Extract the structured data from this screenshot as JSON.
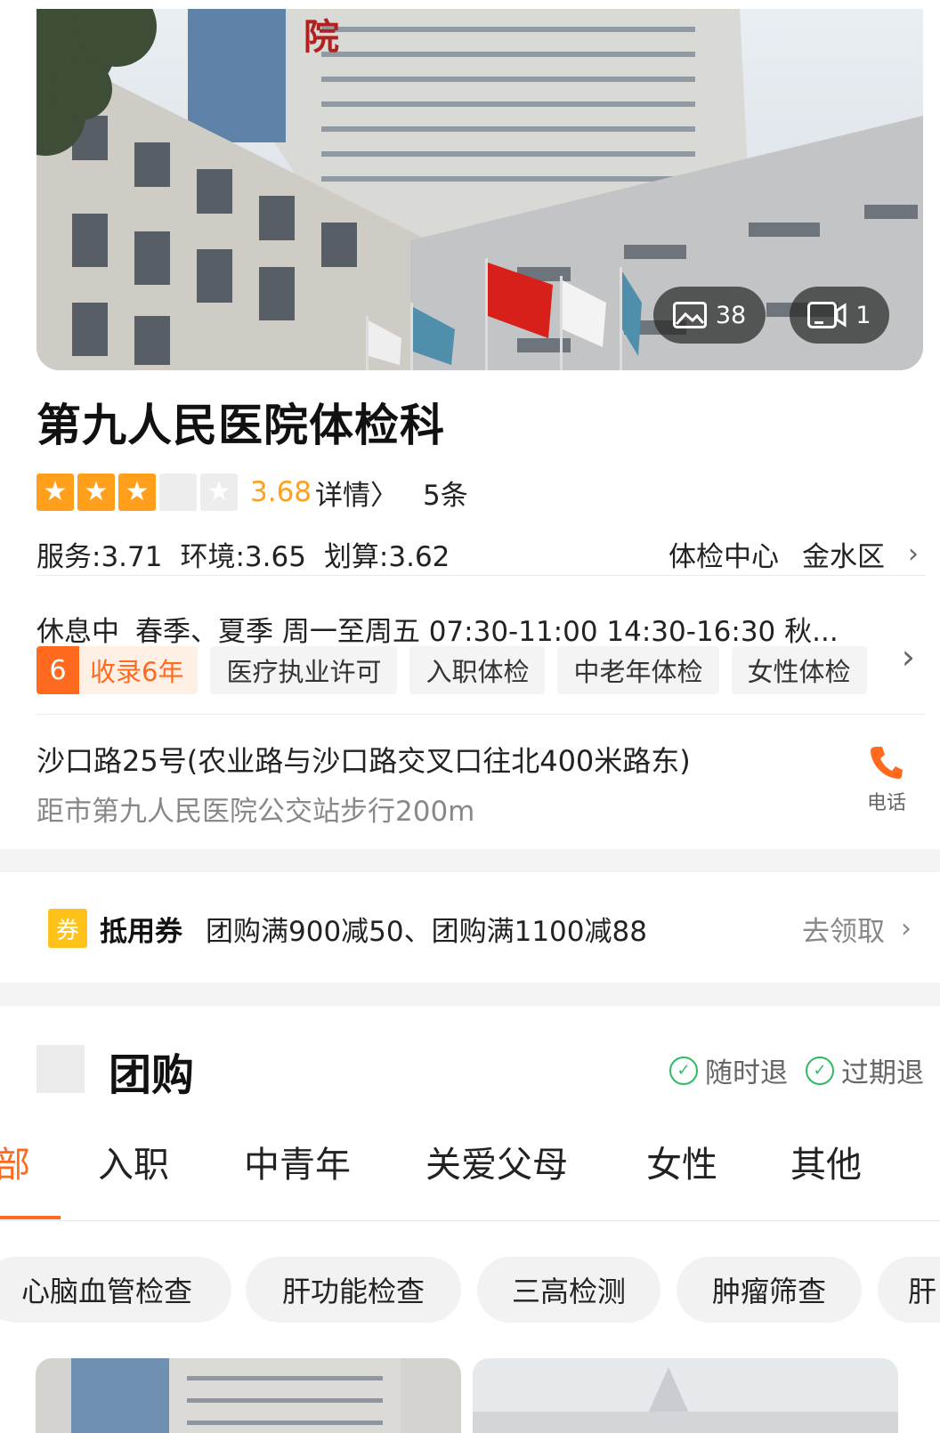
{
  "hero": {
    "photo_count": "38",
    "video_count": "1",
    "photo_icon": "image-icon",
    "video_icon": "video-camera-icon"
  },
  "shop": {
    "name": "第九人民医院体检科",
    "rating": 3.68,
    "rating_text": "3.68",
    "detail_link": "详情〉",
    "review_count": "5条",
    "sub_scores": [
      "服务:3.71",
      "环境:3.65",
      "划算:3.62"
    ],
    "category": "体检中心",
    "district": "金水区",
    "status": "休息中",
    "hours": "春季、夏季 周一至周五 07:30-11:00 14:30-16:30  秋...",
    "badge_num": "6",
    "badge_text": "收录6年",
    "tags": [
      "医疗执业许可",
      "入职体检",
      "中老年体检",
      "女性体检"
    ],
    "address": "沙口路25号(农业路与沙口路交叉口往北400米路东)",
    "address_hint": "距市第九人民医院公交站步行200m",
    "phone_label": "电话"
  },
  "coupon": {
    "icon_text": "券",
    "title": "抵用券",
    "text": "团购满900减50、团购满1100减88",
    "action": "去领取"
  },
  "groupbuy": {
    "title": "团购",
    "guarantees": [
      "随时退",
      "过期退"
    ],
    "tabs": [
      "部",
      "入职",
      "中青年",
      "关爱父母",
      "女性",
      "其他"
    ],
    "active_tab": 0,
    "filters": [
      "心脑血管检查",
      "肝功能检查",
      "三高检测",
      "肿瘤筛查",
      "肝"
    ]
  },
  "colors": {
    "accent": "#ff6a1f",
    "star": "#ff9f1c",
    "coupon": "#ffc21a",
    "check": "#2dbb62"
  }
}
